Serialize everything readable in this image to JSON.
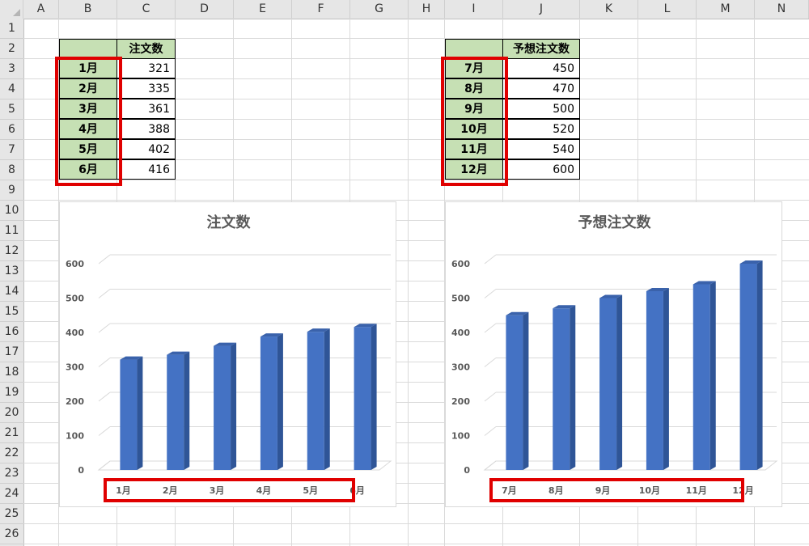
{
  "columns": [
    "A",
    "B",
    "C",
    "D",
    "E",
    "F",
    "G",
    "H",
    "I",
    "J",
    "K",
    "L",
    "M",
    "N"
  ],
  "rows": [
    "1",
    "2",
    "3",
    "4",
    "5",
    "6",
    "7",
    "8",
    "9",
    "10",
    "11",
    "12",
    "13",
    "14",
    "15",
    "16",
    "17",
    "18",
    "19",
    "20",
    "21",
    "22",
    "23",
    "24",
    "25",
    "26"
  ],
  "table1": {
    "header_value": "注文数",
    "rows": [
      {
        "label": "1月",
        "value": "321"
      },
      {
        "label": "2月",
        "value": "335"
      },
      {
        "label": "3月",
        "value": "361"
      },
      {
        "label": "4月",
        "value": "388"
      },
      {
        "label": "5月",
        "value": "402"
      },
      {
        "label": "6月",
        "value": "416"
      }
    ]
  },
  "table2": {
    "header_value": "予想注文数",
    "rows": [
      {
        "label": "7月",
        "value": "450"
      },
      {
        "label": "8月",
        "value": "470"
      },
      {
        "label": "9月",
        "value": "500"
      },
      {
        "label": "10月",
        "value": "520"
      },
      {
        "label": "11月",
        "value": "540"
      },
      {
        "label": "12月",
        "value": "600"
      }
    ]
  },
  "colors": {
    "bar": "#4472c4",
    "bar_side": "#2f5597",
    "bar_top": "#3a62ab",
    "highlight": "#e00000",
    "label_bg": "#c6e0b4"
  },
  "chart_data": [
    {
      "type": "bar",
      "title": "注文数",
      "categories": [
        "1月",
        "2月",
        "3月",
        "4月",
        "5月",
        "6月"
      ],
      "values": [
        321,
        335,
        361,
        388,
        402,
        416
      ],
      "yticks": [
        0,
        100,
        200,
        300,
        400,
        500,
        600
      ],
      "ylim": [
        0,
        600
      ],
      "grid": true,
      "style": "3d-column"
    },
    {
      "type": "bar",
      "title": "予想注文数",
      "categories": [
        "7月",
        "8月",
        "9月",
        "10月",
        "11月",
        "12月"
      ],
      "values": [
        450,
        470,
        500,
        520,
        540,
        600
      ],
      "yticks": [
        0,
        100,
        200,
        300,
        400,
        500,
        600
      ],
      "ylim": [
        0,
        600
      ],
      "grid": true,
      "style": "3d-column"
    }
  ]
}
